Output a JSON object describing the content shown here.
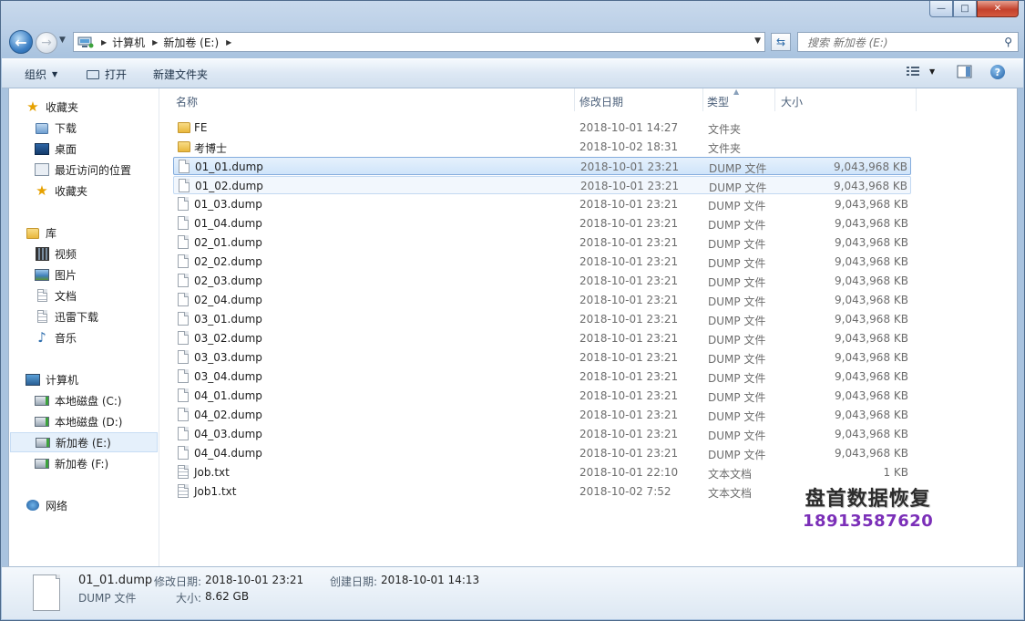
{
  "window": {
    "controls": {
      "minimize": "—",
      "maximize": "□",
      "close": "✕"
    }
  },
  "address": {
    "crumbs": [
      "计算机",
      "新加卷 (E:)"
    ],
    "search_placeholder": "搜索 新加卷 (E:)"
  },
  "toolbar": {
    "organize": "组织",
    "open": "打开",
    "new_folder": "新建文件夹"
  },
  "nav": {
    "favorites_header": "收藏夹",
    "favorites": [
      "下载",
      "桌面",
      "最近访问的位置",
      "收藏夹"
    ],
    "libraries_header": "库",
    "libraries": [
      "视频",
      "图片",
      "文档",
      "迅雷下载",
      "音乐"
    ],
    "computer_header": "计算机",
    "drives": [
      "本地磁盘 (C:)",
      "本地磁盘 (D:)",
      "新加卷 (E:)",
      "新加卷 (F:)"
    ],
    "network_header": "网络"
  },
  "columns": {
    "name": "名称",
    "date": "修改日期",
    "type": "类型",
    "size": "大小"
  },
  "files": [
    {
      "name": "FE",
      "date": "2018-10-01 14:27",
      "type": "文件夹",
      "size": "",
      "kind": "folder"
    },
    {
      "name": "考博士",
      "date": "2018-10-02 18:31",
      "type": "文件夹",
      "size": "",
      "kind": "folder"
    },
    {
      "name": "01_01.dump",
      "date": "2018-10-01 23:21",
      "type": "DUMP 文件",
      "size": "9,043,968 KB",
      "kind": "doc"
    },
    {
      "name": "01_02.dump",
      "date": "2018-10-01 23:21",
      "type": "DUMP 文件",
      "size": "9,043,968 KB",
      "kind": "doc"
    },
    {
      "name": "01_03.dump",
      "date": "2018-10-01 23:21",
      "type": "DUMP 文件",
      "size": "9,043,968 KB",
      "kind": "doc"
    },
    {
      "name": "01_04.dump",
      "date": "2018-10-01 23:21",
      "type": "DUMP 文件",
      "size": "9,043,968 KB",
      "kind": "doc"
    },
    {
      "name": "02_01.dump",
      "date": "2018-10-01 23:21",
      "type": "DUMP 文件",
      "size": "9,043,968 KB",
      "kind": "doc"
    },
    {
      "name": "02_02.dump",
      "date": "2018-10-01 23:21",
      "type": "DUMP 文件",
      "size": "9,043,968 KB",
      "kind": "doc"
    },
    {
      "name": "02_03.dump",
      "date": "2018-10-01 23:21",
      "type": "DUMP 文件",
      "size": "9,043,968 KB",
      "kind": "doc"
    },
    {
      "name": "02_04.dump",
      "date": "2018-10-01 23:21",
      "type": "DUMP 文件",
      "size": "9,043,968 KB",
      "kind": "doc"
    },
    {
      "name": "03_01.dump",
      "date": "2018-10-01 23:21",
      "type": "DUMP 文件",
      "size": "9,043,968 KB",
      "kind": "doc"
    },
    {
      "name": "03_02.dump",
      "date": "2018-10-01 23:21",
      "type": "DUMP 文件",
      "size": "9,043,968 KB",
      "kind": "doc"
    },
    {
      "name": "03_03.dump",
      "date": "2018-10-01 23:21",
      "type": "DUMP 文件",
      "size": "9,043,968 KB",
      "kind": "doc"
    },
    {
      "name": "03_04.dump",
      "date": "2018-10-01 23:21",
      "type": "DUMP 文件",
      "size": "9,043,968 KB",
      "kind": "doc"
    },
    {
      "name": "04_01.dump",
      "date": "2018-10-01 23:21",
      "type": "DUMP 文件",
      "size": "9,043,968 KB",
      "kind": "doc"
    },
    {
      "name": "04_02.dump",
      "date": "2018-10-01 23:21",
      "type": "DUMP 文件",
      "size": "9,043,968 KB",
      "kind": "doc"
    },
    {
      "name": "04_03.dump",
      "date": "2018-10-01 23:21",
      "type": "DUMP 文件",
      "size": "9,043,968 KB",
      "kind": "doc"
    },
    {
      "name": "04_04.dump",
      "date": "2018-10-01 23:21",
      "type": "DUMP 文件",
      "size": "9,043,968 KB",
      "kind": "doc"
    },
    {
      "name": "Job.txt",
      "date": "2018-10-01 22:10",
      "type": "文本文档",
      "size": "1 KB",
      "kind": "txt"
    },
    {
      "name": "Job1.txt",
      "date": "2018-10-02 7:52",
      "type": "文本文档",
      "size": "",
      "kind": "txt"
    }
  ],
  "selection": {
    "primary": 2,
    "secondary": 3
  },
  "watermark": {
    "line1": "盘首数据恢复",
    "line2": "18913587620"
  },
  "details": {
    "name": "01_01.dump",
    "type": "DUMP 文件",
    "modified_label": "修改日期:",
    "modified": "2018-10-01 23:21",
    "created_label": "创建日期:",
    "created": "2018-10-01 14:13",
    "size_label": "大小:",
    "size": "8.62 GB"
  },
  "colors": {
    "selection": "#cfe4fa",
    "selection_border": "#84acdd",
    "watermark_number": "#7b2fb8"
  }
}
